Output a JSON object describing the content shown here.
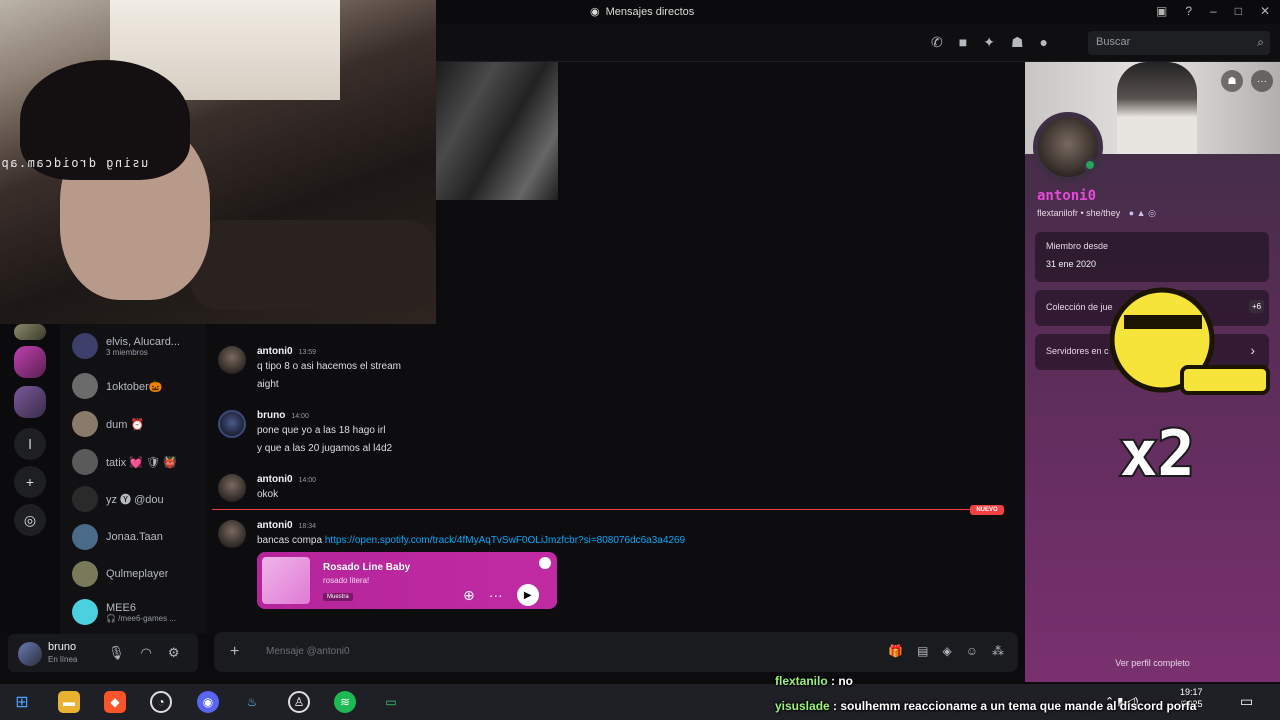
{
  "window": {
    "title": "Mensajes directos"
  },
  "header": {
    "search_placeholder": "Buscar"
  },
  "webcam": {
    "watermark": "using droidcam.ap"
  },
  "dm_list": [
    {
      "name": "elvis, Alucard...",
      "sub": "3 miembros",
      "avatar_color": "#3b3f6a"
    },
    {
      "name": "1oktober🎃",
      "sub": "",
      "avatar_color": "#6b6b6b"
    },
    {
      "name": "dum ⏰",
      "sub": "",
      "avatar_color": "#8a7a6a"
    },
    {
      "name": "tatix 💓 🛡 👹",
      "sub": "",
      "avatar_color": "#5a5a5a"
    },
    {
      "name": "yz 🅨 @dou",
      "sub": "",
      "avatar_color": "#2a2a2a"
    },
    {
      "name": "Jonaa.Taan",
      "sub": "",
      "avatar_color": "#4a6a8a"
    },
    {
      "name": "Qulmeplayer",
      "sub": "",
      "avatar_color": "#7a7a5a"
    },
    {
      "name": "MEE6",
      "sub": "🎧 /mee6-games ...",
      "avatar_color": "#4bd0e0"
    }
  ],
  "user_panel": {
    "username": "bruno",
    "status": "En línea"
  },
  "messages": [
    {
      "author": "antoni0",
      "time": "13:59",
      "lines": [
        "q tipo 8 o asi hacemos el stream",
        "aight"
      ],
      "kind": "antoni"
    },
    {
      "author": "bruno",
      "time": "14:00",
      "lines": [
        "pone que yo a las 18 hago irl",
        "y que a las 20 jugamos al l4d2"
      ],
      "kind": "bruno"
    },
    {
      "author": "antoni0",
      "time": "14:00",
      "lines": [
        "okok"
      ],
      "kind": "antoni"
    },
    {
      "author": "antoni0",
      "time": "18:34",
      "lines": [
        "bancas compa "
      ],
      "kind": "antoni",
      "link": "https://open.spotify.com/track/4fMyAqTvSwF0OLiJmzfcbr?si=808076dc6a3a4269"
    }
  ],
  "new_badge": "NUEVO",
  "spotify": {
    "title": "Rosado Line Baby",
    "artist": "rosado litera!",
    "tag": "Muestra"
  },
  "composer": {
    "placeholder": "Mensaje @antoni0"
  },
  "profile": {
    "display_name": "antoni0",
    "tagline": "flextanilofr • she/they",
    "member_since_label": "Miembro desde",
    "member_since_value": "31 ene 2020",
    "collection_label": "Colección de jue",
    "collection_more": "+6",
    "servers_label": "Servidores en c",
    "full_profile": "Ver perfil completo"
  },
  "emote": {
    "text": "x2"
  },
  "taskbar": {
    "time": "19:17",
    "date_fragment": "/2025"
  },
  "stream_chat": [
    {
      "user": "flextanilo",
      "text": " : no"
    },
    {
      "user": "yisuslade",
      "text": " : soulhemm reaccioname a un tema que mande al discord porfa"
    }
  ],
  "colors": {
    "accent_pink": "#e64ad8",
    "unread_red": "#f23f42",
    "link_blue": "#00a8fc",
    "online_green": "#23a55a",
    "spotify_pink": "#b5249a"
  }
}
